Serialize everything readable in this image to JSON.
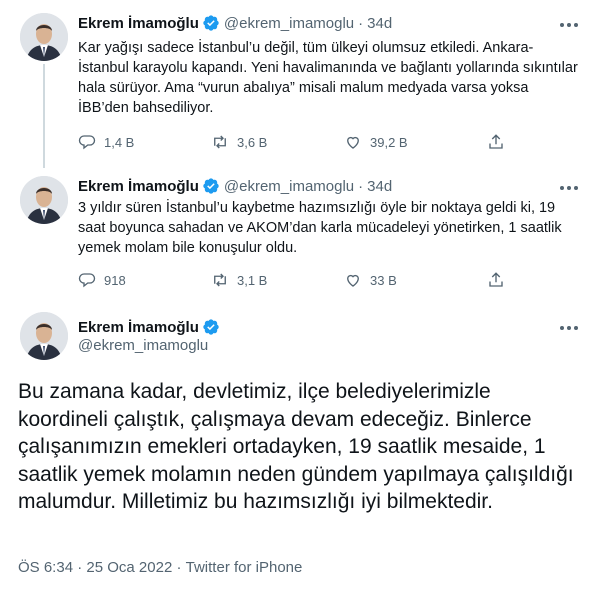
{
  "tweets": [
    {
      "name": "Ekrem İmamoğlu",
      "handle": "@ekrem_imamoglu",
      "separator": "·",
      "time": "34d",
      "text": "Kar yağışı sadece İstanbul’u değil, tüm ülkeyi olumsuz etkiledi. Ankara-İstanbul karayolu kapandı. Yeni havalimanında ve bağlantı yollarında sıkıntılar hala sürüyor. Ama “vurun abalıya” misali malum medyada varsa yoksa İBB’den bahsediliyor.",
      "replies": "1,4 B",
      "retweets": "3,6 B",
      "likes": "39,2 B"
    },
    {
      "name": "Ekrem İmamoğlu",
      "handle": "@ekrem_imamoglu",
      "separator": "·",
      "time": "34d",
      "text": "3 yıldır süren İstanbul’u kaybetme hazımsızlığı öyle bir noktaya geldi ki, 19 saat boyunca sahadan ve AKOM’dan karla mücadeleyi yönetirken, 1 saatlik yemek molam bile konuşulur oldu.",
      "replies": "918",
      "retweets": "3,1 B",
      "likes": "33 B"
    }
  ],
  "focus": {
    "name": "Ekrem İmamoğlu",
    "handle": "@ekrem_imamoglu",
    "text": "Bu zamana kadar, devletimiz, ilçe belediyelerimizle koordineli çalıştık, çalışmaya devam edeceğiz. Binlerce çalışanımızın emekleri ortadayken, 19 saatlik mesaide, 1 saatlik yemek molamın neden gündem yapılmaya çalışıldığı malumdur. Milletimiz bu hazımsızlığı iyi bilmektedir.",
    "time": "ÖS 6:34",
    "separator": " · ",
    "date": "25 Oca 2022",
    "source": "Twitter for iPhone"
  },
  "colors": {
    "verified": "#1d9bf0",
    "text": "#0f1419",
    "muted": "#536471",
    "thread_line": "#cfd9de"
  }
}
